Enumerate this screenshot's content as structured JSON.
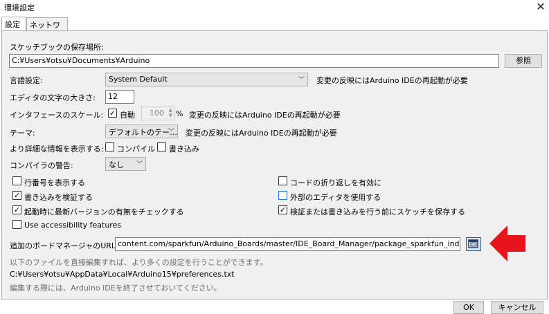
{
  "window": {
    "title": "環境設定",
    "close_glyph": "✕"
  },
  "tabs": [
    {
      "label": "設定"
    },
    {
      "label": "ネットワーク"
    }
  ],
  "sketchbook": {
    "label": "スケッチブックの保存場所:",
    "value": "C:¥Users¥otsu¥Documents¥Arduino",
    "browse_label": "参照"
  },
  "language": {
    "label": "言語設定:",
    "value": "System Default",
    "note": "変更の反映にはArduino IDEの再起動が必要"
  },
  "font_size": {
    "label": "エディタの文字の大きさ:",
    "value": "12"
  },
  "scale": {
    "label": "インタフェースのスケール:",
    "auto_label": "自動",
    "auto_checked": "✓",
    "value": "100",
    "unit": "%",
    "note": "変更の反映にはArduino IDEの再起動が必要"
  },
  "theme": {
    "label": "テーマ:",
    "value": "デフォルトのテー…",
    "note": "変更の反映にはArduino IDEの再起動が必要"
  },
  "verbose": {
    "label": "より詳細な情報を表示する:",
    "compile_label": "コンパイル",
    "upload_label": "書き込み"
  },
  "warnings": {
    "label": "コンパイラの警告:",
    "value": "なし"
  },
  "options": {
    "line_numbers": {
      "label": "行番号を表示する",
      "checked": ""
    },
    "verify_upload": {
      "label": "書き込みを検証する",
      "checked": "✓"
    },
    "check_updates": {
      "label": "起動時に最新バージョンの有無をチェックする",
      "checked": "✓"
    },
    "accessibility": {
      "label": "Use accessibility features",
      "checked": ""
    },
    "code_folding": {
      "label": "コードの折り返しを有効に",
      "checked": ""
    },
    "external_editor": {
      "label": "外部のエディタを使用する",
      "checked": ""
    },
    "save_before": {
      "label": "検証または書き込みを行う前にスケッチを保存する",
      "checked": "✓"
    }
  },
  "board_urls": {
    "label": "追加のボードマネージャのURL:",
    "value": "content.com/sparkfun/Arduino_Boards/master/IDE_Board_Manager/package_sparkfun_index.json"
  },
  "info": {
    "hint": "以下のファイルを直接編集すれば、より多くの設定を行うことができます。",
    "path": "C:¥Users¥otsu¥AppData¥Local¥Arduino15¥preferences.txt",
    "warning": "編集する際には、Arduino IDEを終了させておいてください。"
  },
  "footer": {
    "ok_label": "OK",
    "cancel_label": "キャンセル"
  },
  "colors": {
    "arrow": "#e8141b",
    "panel": "#f0f0f0"
  }
}
